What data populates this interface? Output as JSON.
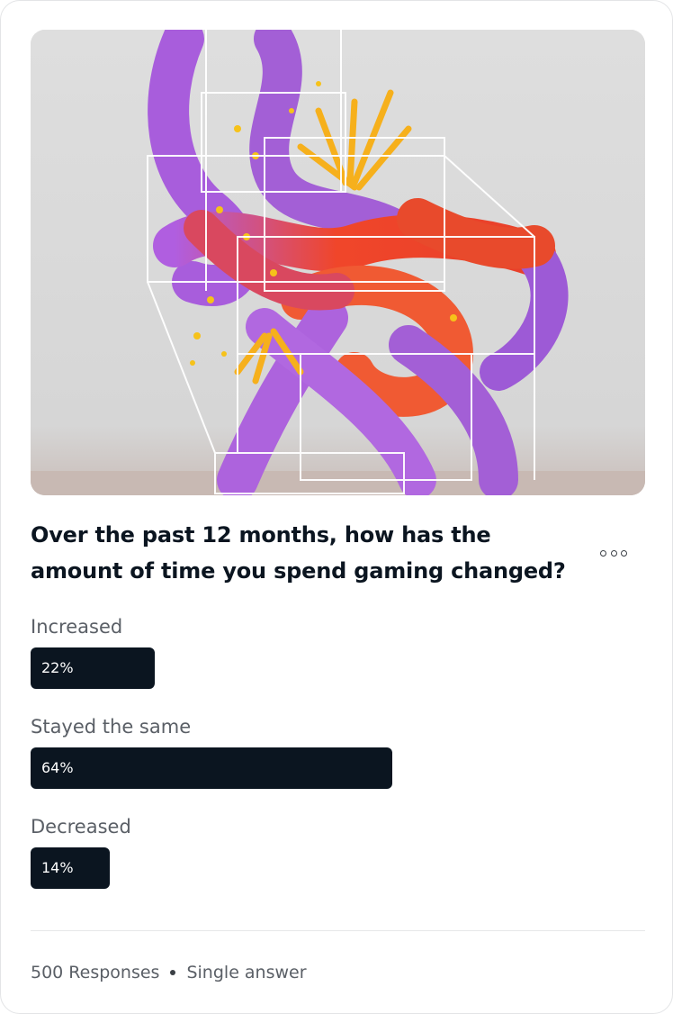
{
  "poll": {
    "question": "Over the past 12 months, how has the amount of time you spend gaming changed?",
    "options": [
      {
        "label": "Increased",
        "percent_label": "22%",
        "value": 0.22
      },
      {
        "label": "Stayed the same",
        "percent_label": "64%",
        "value": 0.64
      },
      {
        "label": "Decreased",
        "percent_label": "14%",
        "value": 0.14
      }
    ],
    "footer": {
      "responses": "500 Responses",
      "answer_type": "Single answer"
    }
  },
  "hero": {
    "icon": "abstract-3d-sculpture-image"
  },
  "menu": {
    "icon": "more-options-icon"
  },
  "colors": {
    "bar": "#0b1520",
    "text_primary": "#0b1520",
    "text_secondary": "#5a5f66",
    "purple": "#a35fd6",
    "orange": "#f15a2b",
    "yellow": "#f7b21a"
  }
}
